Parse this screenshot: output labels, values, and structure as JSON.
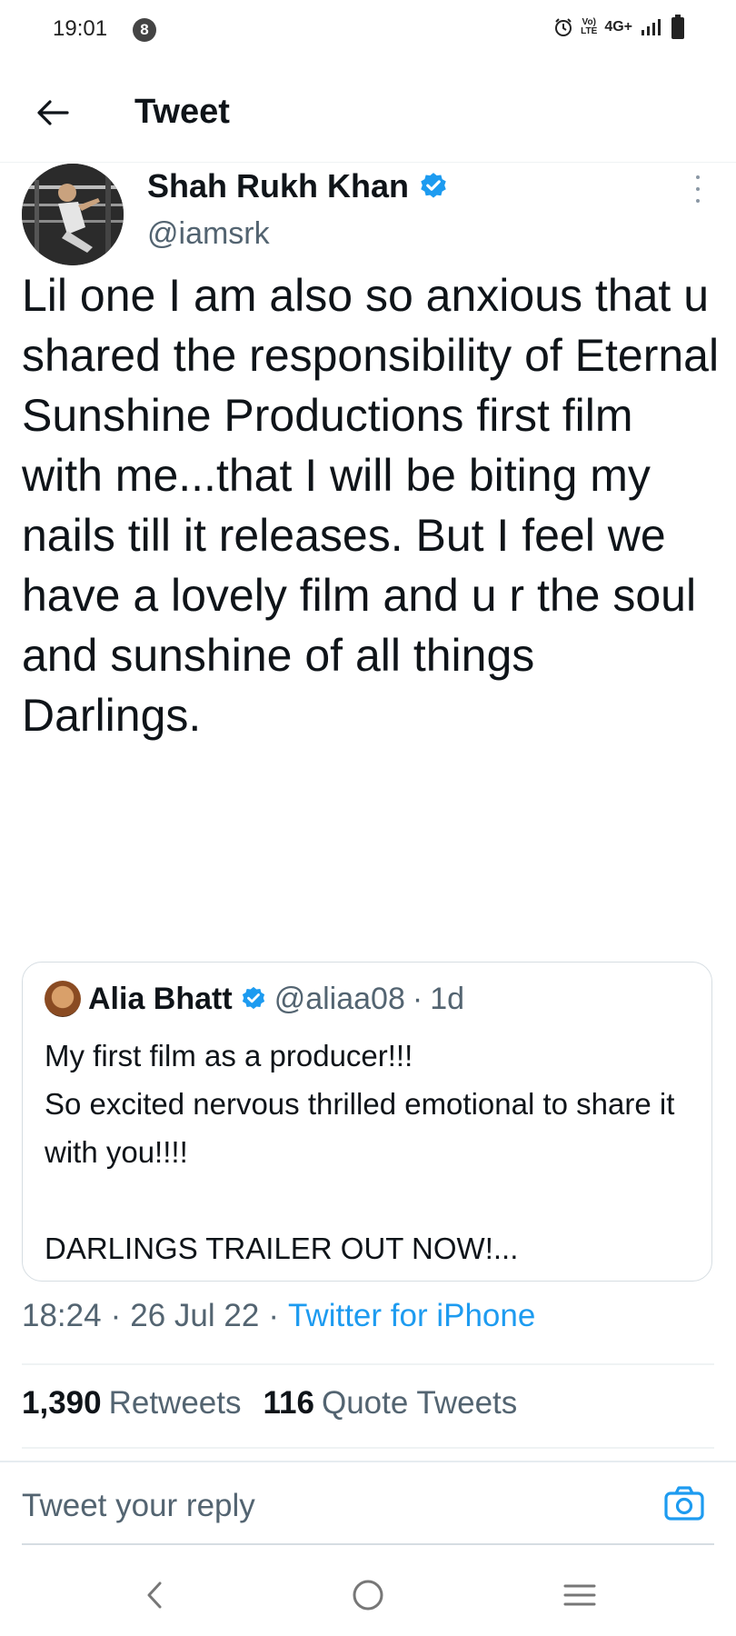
{
  "status_bar": {
    "time": "19:01",
    "notification_count": "8",
    "lte_label": "Vo)\nLTE",
    "network": "4G+",
    "icons": [
      "alarm-icon",
      "volte-icon",
      "signal-icon",
      "battery-icon"
    ]
  },
  "header": {
    "back_icon": "arrow-left-icon",
    "title": "Tweet"
  },
  "tweet": {
    "author_name": "Shah Rukh Khan",
    "author_handle": "@iamsrk",
    "verified": true,
    "text": "Lil one I am also so anxious that u shared the responsibility of Eternal Sunshine Productions first film with me...that I will be biting my nails till it releases. But I feel we have a lovely film and u r the soul and sunshine of all things Darlings.",
    "quote": {
      "author_name": "Alia Bhatt",
      "author_handle": "@aliaa08",
      "separator": "·",
      "time": "1d",
      "lines": [
        "My first film as a producer!!!",
        "So excited nervous thrilled emotional to share it with you!!!!",
        "",
        "DARLINGS TRAILER OUT NOW!..."
      ]
    },
    "timestamp_time": "18:24",
    "timestamp_date": "26 Jul 22",
    "separator": "·",
    "source": "Twitter for iPhone",
    "stats": {
      "retweets_count": "1,390",
      "retweets_label": "Retweets",
      "quotes_count": "116",
      "quotes_label": "Quote Tweets"
    }
  },
  "reply": {
    "placeholder": "Tweet your reply"
  },
  "colors": {
    "accent": "#1d9bf0",
    "text_primary": "#0f1419",
    "text_secondary": "#536471",
    "verified": "#1d9bf0"
  }
}
